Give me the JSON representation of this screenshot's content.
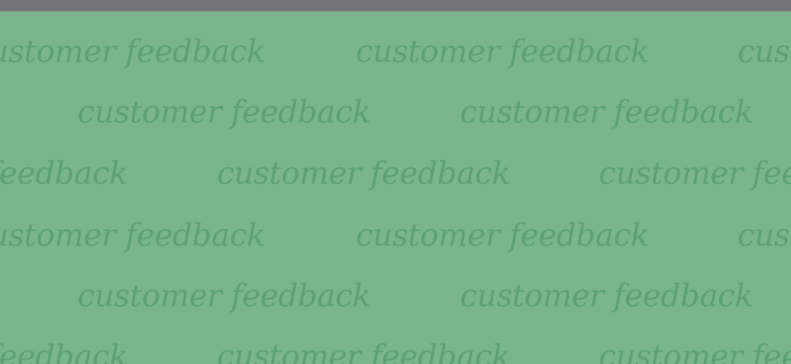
{
  "top_bar": {
    "color": "#747479"
  },
  "background": {
    "color": "#7bb58c",
    "text_color": "#5aa272"
  },
  "watermark_text": "customer feedback"
}
